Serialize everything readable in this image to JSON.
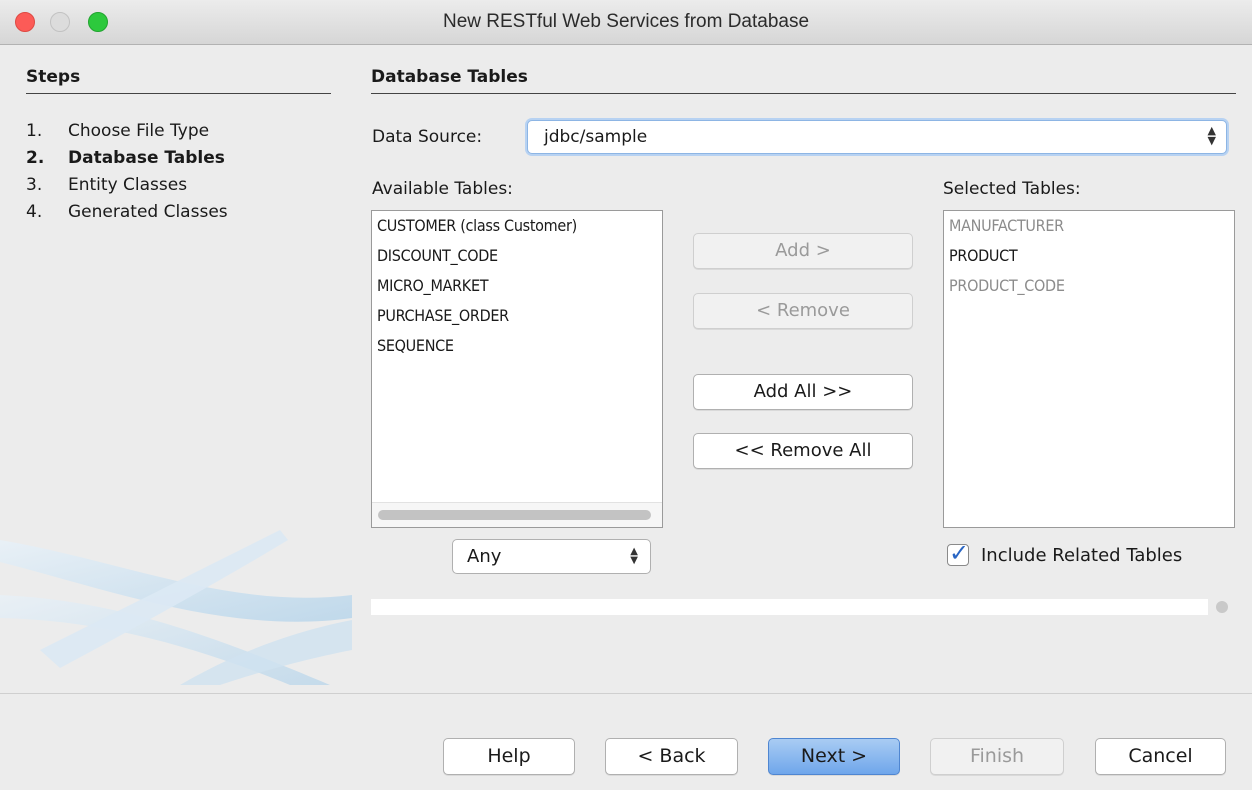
{
  "window": {
    "title": "New RESTful Web Services from Database"
  },
  "steps": {
    "heading": "Steps",
    "items": [
      {
        "num": "1.",
        "label": "Choose File Type",
        "active": false
      },
      {
        "num": "2.",
        "label": "Database Tables",
        "active": true
      },
      {
        "num": "3.",
        "label": "Entity Classes",
        "active": false
      },
      {
        "num": "4.",
        "label": "Generated Classes",
        "active": false
      }
    ]
  },
  "panel": {
    "heading": "Database Tables"
  },
  "data_source": {
    "label": "Data Source:",
    "value": "jdbc/sample"
  },
  "available": {
    "label": "Available Tables:",
    "items": [
      "CUSTOMER (class Customer)",
      "DISCOUNT_CODE",
      "MICRO_MARKET",
      "PURCHASE_ORDER",
      "SEQUENCE"
    ],
    "filter": "Any"
  },
  "selected": {
    "label": "Selected Tables:",
    "items": [
      {
        "name": "MANUFACTURER",
        "dim": true
      },
      {
        "name": "PRODUCT",
        "dim": false
      },
      {
        "name": "PRODUCT_CODE",
        "dim": true
      }
    ]
  },
  "buttons": {
    "add": "Add >",
    "remove": "< Remove",
    "add_all": "Add All >>",
    "remove_all": "<< Remove All"
  },
  "include_related": {
    "label": "Include Related Tables",
    "checked": true
  },
  "footer": {
    "help": "Help",
    "back": "< Back",
    "next": "Next >",
    "finish": "Finish",
    "cancel": "Cancel"
  },
  "colors": {
    "accent": "#6fa6eb",
    "focus": "#b7d2f2",
    "close": "#fc5b57",
    "maximize": "#2dc93d"
  }
}
